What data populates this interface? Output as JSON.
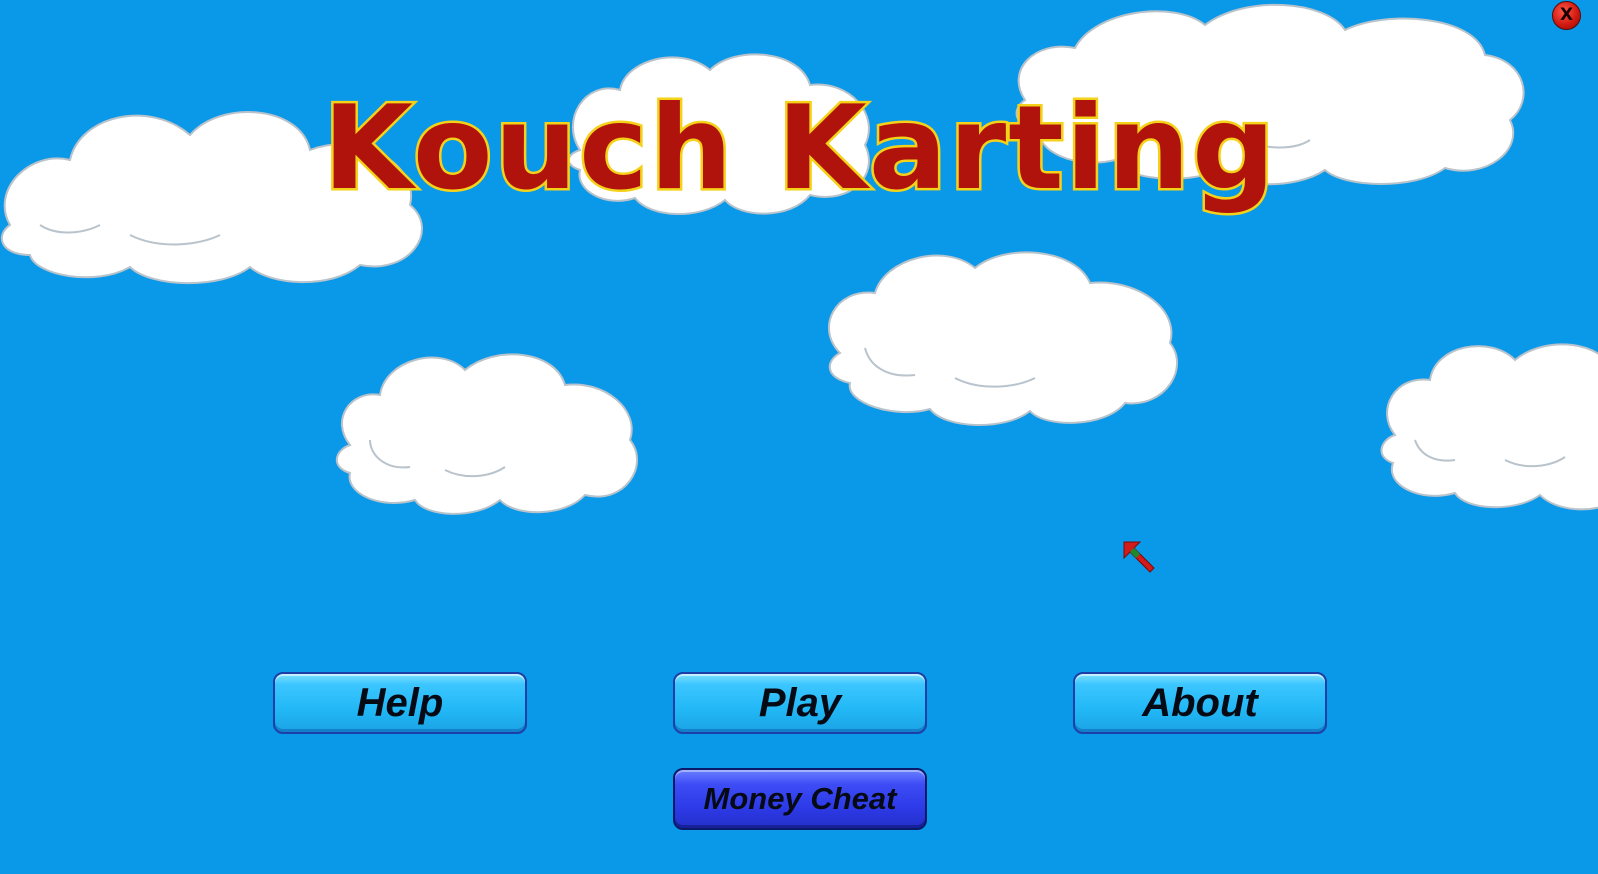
{
  "game": {
    "title": "Kouch Karting",
    "close_label": "X"
  },
  "menu": {
    "help_label": "Help",
    "play_label": "Play",
    "about_label": "About",
    "money_cheat_label": "Money Cheat"
  },
  "colors": {
    "sky": "#0a98e8",
    "title_fill": "#b0120c",
    "title_outline": "#f4d21a",
    "button_blue": "#22b8f6",
    "button_cheat": "#2d3ae8",
    "close_red": "#d31a10"
  },
  "icons": {
    "cursor": "arrow-cursor-icon",
    "close": "close-icon"
  }
}
